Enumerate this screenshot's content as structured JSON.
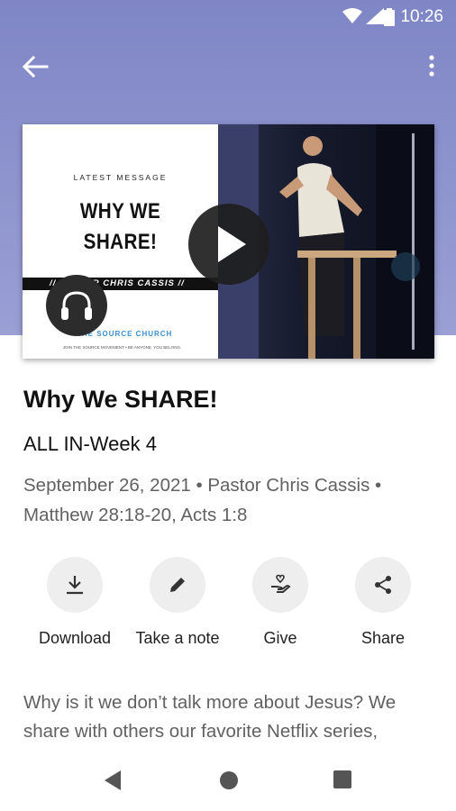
{
  "status_bar": {
    "time": "10:26"
  },
  "thumbnail": {
    "latest_label": "LATEST MESSAGE",
    "title_line1": "WHY WE",
    "title_line2": "SHARE!",
    "pastor_band": "// PASTOR CHRIS CASSIS //",
    "logo_text": "THE SOURCE CHURCH",
    "tagline": "JOIN THE SOURCE MOVEMENT • BE ANYONE. YOU BELONG."
  },
  "sermon": {
    "title": "Why We SHARE!",
    "series": "ALL IN-Week 4",
    "meta_line1": "September 26, 2021 • Pastor Chris Cassis •",
    "meta_line2": "Matthew 28:18-20, Acts 1:8"
  },
  "actions": [
    {
      "label": "Download",
      "icon": "download-icon"
    },
    {
      "label": "Take a note",
      "icon": "pencil-icon"
    },
    {
      "label": "Give",
      "icon": "give-icon"
    },
    {
      "label": "Share",
      "icon": "share-icon"
    }
  ],
  "description": {
    "line1": "Why is it we don’t talk more about Jesus? We",
    "line2": "share with others our favorite Netflix series,"
  },
  "colors": {
    "hero": "#8a90cc",
    "icon_bg": "#eeeeee",
    "meta_text": "#616161"
  }
}
